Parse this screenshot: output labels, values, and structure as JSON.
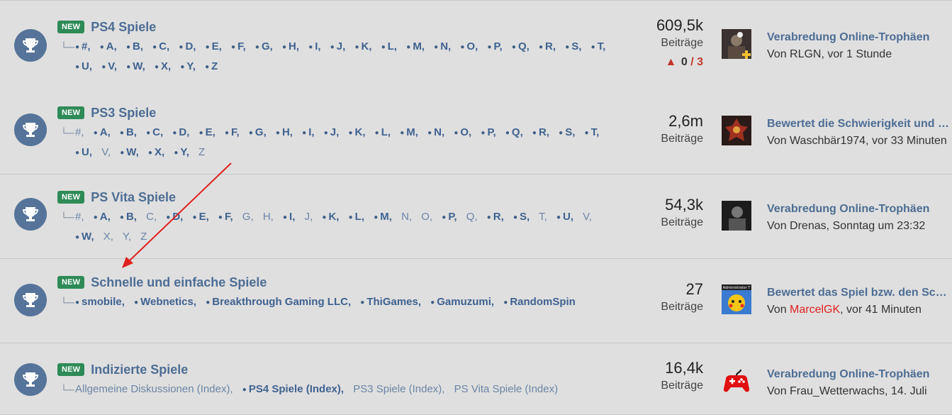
{
  "nodes": [
    {
      "badge": "NEW",
      "title": "PS4 Spiele",
      "subforums": [
        {
          "label": "#,",
          "unread": true
        },
        {
          "label": "A,",
          "unread": true
        },
        {
          "label": "B,",
          "unread": true
        },
        {
          "label": "C,",
          "unread": true
        },
        {
          "label": "D,",
          "unread": true
        },
        {
          "label": "E,",
          "unread": true
        },
        {
          "label": "F,",
          "unread": true
        },
        {
          "label": "G,",
          "unread": true
        },
        {
          "label": "H,",
          "unread": true
        },
        {
          "label": "I,",
          "unread": true
        },
        {
          "label": "J,",
          "unread": true
        },
        {
          "label": "K,",
          "unread": true
        },
        {
          "label": "L,",
          "unread": true
        },
        {
          "label": "M,",
          "unread": true
        },
        {
          "label": "N,",
          "unread": true
        },
        {
          "label": "O,",
          "unread": true
        },
        {
          "label": "P,",
          "unread": true
        },
        {
          "label": "Q,",
          "unread": true
        },
        {
          "label": "R,",
          "unread": true
        },
        {
          "label": "S,",
          "unread": true
        },
        {
          "label": "T,",
          "unread": true
        },
        {
          "label": "U,",
          "unread": true
        },
        {
          "label": "V,",
          "unread": true
        },
        {
          "label": "W,",
          "unread": true
        },
        {
          "label": "X,",
          "unread": true
        },
        {
          "label": "Y,",
          "unread": true
        },
        {
          "label": "Z",
          "unread": true
        }
      ],
      "count": "609,5k",
      "count_label": "Beiträge",
      "reports": {
        "current": "0",
        "separator": "/",
        "total": "3"
      },
      "latest_title": "Verabredung Online-Trophäen",
      "latest_meta_prefix": "Von RLGN, vor 1 Stunde",
      "latest_user": "",
      "latest_meta_suffix": ""
    },
    {
      "badge": "NEW",
      "title": "PS3 Spiele",
      "subforums": [
        {
          "label": "#,",
          "unread": false
        },
        {
          "label": "A,",
          "unread": true
        },
        {
          "label": "B,",
          "unread": true
        },
        {
          "label": "C,",
          "unread": true
        },
        {
          "label": "D,",
          "unread": true
        },
        {
          "label": "E,",
          "unread": true
        },
        {
          "label": "F,",
          "unread": true
        },
        {
          "label": "G,",
          "unread": true
        },
        {
          "label": "H,",
          "unread": true
        },
        {
          "label": "I,",
          "unread": true
        },
        {
          "label": "J,",
          "unread": true
        },
        {
          "label": "K,",
          "unread": true
        },
        {
          "label": "L,",
          "unread": true
        },
        {
          "label": "M,",
          "unread": true
        },
        {
          "label": "N,",
          "unread": true
        },
        {
          "label": "O,",
          "unread": true
        },
        {
          "label": "P,",
          "unread": true
        },
        {
          "label": "Q,",
          "unread": true
        },
        {
          "label": "R,",
          "unread": true
        },
        {
          "label": "S,",
          "unread": true
        },
        {
          "label": "T,",
          "unread": true
        },
        {
          "label": "U,",
          "unread": true
        },
        {
          "label": "V,",
          "unread": false
        },
        {
          "label": "W,",
          "unread": true
        },
        {
          "label": "X,",
          "unread": true
        },
        {
          "label": "Y,",
          "unread": true
        },
        {
          "label": "Z",
          "unread": false
        }
      ],
      "count": "2,6m",
      "count_label": "Beiträge",
      "latest_title": "Bewertet die Schwierigkeit und den Zeitaufwand",
      "latest_meta_prefix": "Von Waschbär1974, vor 33 Minuten",
      "latest_user": "",
      "latest_meta_suffix": ""
    },
    {
      "badge": "NEW",
      "title": "PS Vita Spiele",
      "subforums": [
        {
          "label": "#,",
          "unread": false
        },
        {
          "label": "A,",
          "unread": true
        },
        {
          "label": "B,",
          "unread": true
        },
        {
          "label": "C,",
          "unread": false
        },
        {
          "label": "D,",
          "unread": true
        },
        {
          "label": "E,",
          "unread": true
        },
        {
          "label": "F,",
          "unread": true
        },
        {
          "label": "G,",
          "unread": false
        },
        {
          "label": "H,",
          "unread": false
        },
        {
          "label": "I,",
          "unread": true
        },
        {
          "label": "J,",
          "unread": false
        },
        {
          "label": "K,",
          "unread": true
        },
        {
          "label": "L,",
          "unread": true
        },
        {
          "label": "M,",
          "unread": true
        },
        {
          "label": "N,",
          "unread": false
        },
        {
          "label": "O,",
          "unread": false
        },
        {
          "label": "P,",
          "unread": true
        },
        {
          "label": "Q,",
          "unread": false
        },
        {
          "label": "R,",
          "unread": true
        },
        {
          "label": "S,",
          "unread": true
        },
        {
          "label": "T,",
          "unread": false
        },
        {
          "label": "U,",
          "unread": true
        },
        {
          "label": "V,",
          "unread": false
        },
        {
          "label": "W,",
          "unread": true
        },
        {
          "label": "X,",
          "unread": false
        },
        {
          "label": "Y,",
          "unread": false
        },
        {
          "label": "Z",
          "unread": false
        }
      ],
      "count": "54,3k",
      "count_label": "Beiträge",
      "latest_title": "Verabredung Online-Trophäen",
      "latest_meta_prefix": "Von Drenas, Sonntag um 23:32",
      "latest_user": "",
      "latest_meta_suffix": ""
    },
    {
      "badge": "NEW",
      "title": "Schnelle und einfache Spiele",
      "subforums": [
        {
          "label": "smobile,",
          "unread": true
        },
        {
          "label": "Webnetics,",
          "unread": true
        },
        {
          "label": "Breakthrough Gaming LLC,",
          "unread": true
        },
        {
          "label": "ThiGames,",
          "unread": true
        },
        {
          "label": "Gamuzumi,",
          "unread": true
        },
        {
          "label": "RandomSpin",
          "unread": true
        }
      ],
      "count": "27",
      "count_label": "Beiträge",
      "latest_title": "Bewertet das Spiel bzw. den Schwierigkeitsgrad",
      "latest_meta_prefix": "Von ",
      "latest_user": "MarcelGK",
      "latest_meta_suffix": ", vor 41 Minuten",
      "avatar_tag": "Administrator T"
    },
    {
      "badge": "NEW",
      "title": "Indizierte Spiele",
      "subforums": [
        {
          "label": "Allgemeine Diskussionen (Index),",
          "unread": false
        },
        {
          "label": "PS4 Spiele (Index),",
          "unread": true
        },
        {
          "label": "PS3 Spiele (Index),",
          "unread": false
        },
        {
          "label": "PS Vita Spiele (Index)",
          "unread": false
        }
      ],
      "count": "16,4k",
      "count_label": "Beiträge",
      "latest_title": "Verabredung Online-Trophäen",
      "latest_meta_prefix": "Von Frau_Wetterwachs, 14. Juli",
      "latest_user": "",
      "latest_meta_suffix": ""
    }
  ],
  "colors": {
    "accent": "#4d6d94",
    "badge": "#2e8b57",
    "annotation_arrow": "#e02020",
    "warning": "#c0392b"
  },
  "icons": {
    "node": "trophy-icon",
    "branch": "subforum-branch-icon",
    "warning": "warning-triangle-icon"
  }
}
